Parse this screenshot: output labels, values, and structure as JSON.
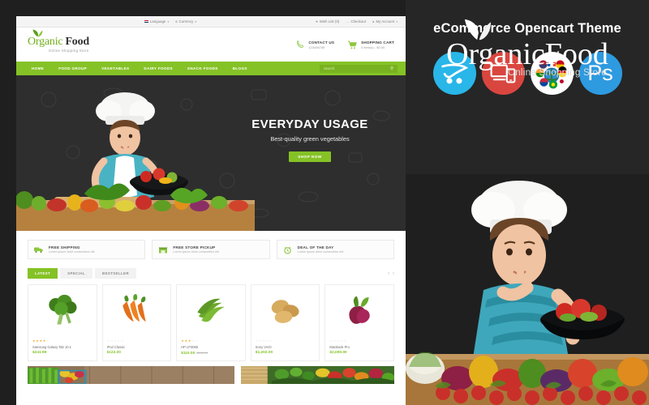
{
  "preview": {
    "topbar": {
      "language": "Language",
      "currency": "Currency",
      "wishlist": "Wish List (0)",
      "checkout": "Checkout",
      "account": "My Account"
    },
    "logo": {
      "word1": "Organic",
      "word2": "Food",
      "tagline": "Online Shopping Store"
    },
    "contact": {
      "label": "CONTACT US",
      "value": "123456789"
    },
    "cart": {
      "label": "SHOPPING CART",
      "value": "0 item(s) - $0.00"
    },
    "nav": [
      "HOME",
      "FOOD GROUP",
      "VEGETABLES",
      "DAIRY FOODS",
      "SNACK FOODS",
      "BLOGS"
    ],
    "search": {
      "placeholder": "Search",
      "icon": "search-icon"
    },
    "hero": {
      "title": "EVERYDAY USAGE",
      "subtitle": "Best-quality green vegetables",
      "cta": "SHOP NOW"
    },
    "services": [
      {
        "title": "FREE SHIPPING",
        "text": "Lorem ipsum dolor consectetur elit.",
        "icon": "truck-icon"
      },
      {
        "title": "FREE STORE PICKUP",
        "text": "Lorem ipsum dolor consectetur elit.",
        "icon": "store-icon"
      },
      {
        "title": "DEAL OF THE DAY",
        "text": "Lorem ipsum dolor consectetur elit.",
        "icon": "alarm-clock-icon"
      }
    ],
    "tabs": [
      {
        "label": "LATEST",
        "active": true
      },
      {
        "label": "SPECIAL",
        "active": false
      },
      {
        "label": "BESTSELLER",
        "active": false
      }
    ],
    "carousel_arrows": {
      "prev": "‹",
      "next": "›"
    },
    "products": [
      {
        "name": "Samsung Galaxy Tab 10.1",
        "price": "$241.99",
        "old_price": "",
        "rating": 4,
        "image": "broccoli"
      },
      {
        "name": "iPod Classic",
        "price": "$122.00",
        "old_price": "",
        "rating": 0,
        "image": "carrots"
      },
      {
        "name": "HP LP3065",
        "price": "$110.00",
        "old_price": "$122.00",
        "rating": 3,
        "image": "green-beans"
      },
      {
        "name": "Sony VAIO",
        "price": "$1,202.00",
        "old_price": "",
        "rating": 0,
        "image": "potatoes"
      },
      {
        "name": "MacBook Pro",
        "price": "$2,000.00",
        "old_price": "",
        "rating": 0,
        "image": "beetroot"
      }
    ]
  },
  "promo": {
    "logo": {
      "word1": "Organic",
      "word2": "Food",
      "tagline": "Online Shopping Store"
    },
    "subtitle": "eCommerce Opencart Theme",
    "badges": [
      {
        "name": "opencart-cart-icon",
        "color": "#29b6e8"
      },
      {
        "name": "responsive-devices-icon",
        "color": "#d9463f"
      },
      {
        "name": "multilanguage-globe-icon",
        "color": "#ffffff"
      },
      {
        "name": "photoshop-icon",
        "color": "#2e9ae0",
        "label": "Ps"
      }
    ]
  },
  "colors": {
    "brand_green": "#85c226",
    "dark_panel": "#262626",
    "hero_dark": "#2e2e2e",
    "price_green": "#85c226",
    "star_gold": "#f0ad2e"
  }
}
